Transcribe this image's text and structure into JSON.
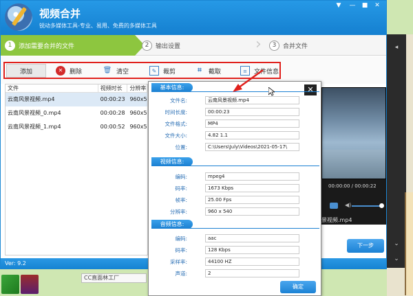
{
  "app": {
    "title": "视频合并",
    "subtitle": "锐动多媒体工具-专业、易用、免费的多媒体工具",
    "version": "Ver: 9.2"
  },
  "window_controls": [
    "▼",
    "—",
    "■",
    "✕"
  ],
  "steps": [
    {
      "num": "1",
      "label": "添加需要合并的文件"
    },
    {
      "num": "2",
      "label": "输出设置"
    },
    {
      "num": "3",
      "label": "合并文件"
    }
  ],
  "toolbar": {
    "add": "添加",
    "delete": "删除",
    "clear": "清空",
    "crop": "裁剪",
    "cut": "截取",
    "file_info": "文件信息"
  },
  "file_list": {
    "headers": [
      "文件",
      "视频时长",
      "分辨率"
    ],
    "rows": [
      {
        "name": "云南风景视频.mp4",
        "duration": "00:00:23",
        "res": "960x5"
      },
      {
        "name": "云南风景视频_0.mp4",
        "duration": "00:00:28",
        "res": "960x5"
      },
      {
        "name": "云南风景视频_1.mp4",
        "duration": "00:00:52",
        "res": "960x5"
      }
    ]
  },
  "preview": {
    "time": "00:00:00 / 00:00:22",
    "filename": "景视频.mp4"
  },
  "next_button": "下一步",
  "dialog": {
    "basic": {
      "title": "基本信息:",
      "fields": [
        {
          "label": "文件名:",
          "value": "云南风景视频.mp4"
        },
        {
          "label": "时间长度:",
          "value": "00:00:23"
        },
        {
          "label": "文件格式:",
          "value": "MP4"
        },
        {
          "label": "文件大小:",
          "value": "4.82 1.1"
        },
        {
          "label": "位置:",
          "value": "C:\\Users\\July\\Videos\\2021-05-17\\"
        }
      ]
    },
    "video": {
      "title": "视频信息:",
      "fields": [
        {
          "label": "编码:",
          "value": "mpeg4"
        },
        {
          "label": "码率:",
          "value": "1673 Kbps"
        },
        {
          "label": "帧率:",
          "value": "25.00 Fps"
        },
        {
          "label": "分辨率:",
          "value": "960 x 540"
        }
      ]
    },
    "audio": {
      "title": "音频信息:",
      "fields": [
        {
          "label": "编码:",
          "value": "aac"
        },
        {
          "label": "码率:",
          "value": "128 Kbps"
        },
        {
          "label": "采样率:",
          "value": "44100 HZ"
        },
        {
          "label": "声道:",
          "value": "2"
        }
      ]
    },
    "ok": "确定",
    "close": "✕"
  },
  "taskbar_text": "CC直面林工厂"
}
